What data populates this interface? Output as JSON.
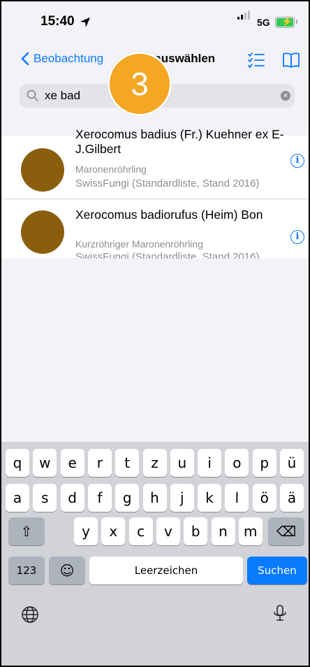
{
  "status_bar": {
    "time": "15:40",
    "network": "5G"
  },
  "nav": {
    "back_label": "Beobachtung",
    "title": "Art auswählen"
  },
  "search": {
    "value": "xe bad",
    "clear_glyph": "×"
  },
  "step_badge": "3",
  "results": [
    {
      "scientific_name": "Xerocomus badius (Fr.) Kuehner ex E-J.Gilbert",
      "common_name": "Maronenröhrling",
      "source": "SwissFungi (Standardliste, Stand 2016)",
      "info_glyph": "i",
      "thumb_color": "#8b5e0e"
    },
    {
      "scientific_name": "Xerocomus badiorufus (Heim) Bon",
      "common_name": "Kurzröhriger Maronenröhrling",
      "source": "SwissFungi (Standardliste, Stand 2016)",
      "info_glyph": "i",
      "thumb_color": "#8b5e0e"
    }
  ],
  "keyboard": {
    "row1": [
      "q",
      "w",
      "e",
      "r",
      "t",
      "z",
      "u",
      "i",
      "o",
      "p",
      "ü"
    ],
    "row2": [
      "a",
      "s",
      "d",
      "f",
      "g",
      "h",
      "j",
      "k",
      "l",
      "ö",
      "ä"
    ],
    "row3": [
      "y",
      "x",
      "c",
      "v",
      "b",
      "n",
      "m"
    ],
    "numbers_label": "123",
    "emoji_glyph": "☺",
    "shift_glyph": "⇧",
    "delete_glyph": "⌫",
    "space_label": "Leerzeichen",
    "go_label": "Suchen"
  },
  "colors": {
    "accent": "#0a7aff",
    "badge": "#f5a623",
    "thumb": "#8b5e0e"
  }
}
